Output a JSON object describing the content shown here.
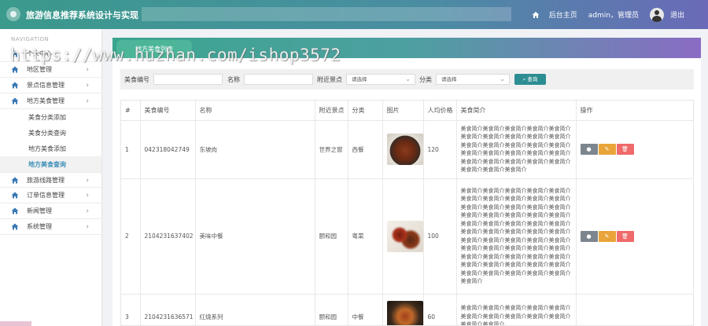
{
  "header": {
    "title": "旅游信息推荐系统设计与实现",
    "home_label": "后台主页",
    "user_label": "admin，管理员",
    "logout_label": "退出"
  },
  "sidebar": {
    "nav_head": "NAVIGATION",
    "items": [
      {
        "label": "个人中心",
        "icon": "home-icon"
      },
      {
        "label": "地区管理",
        "icon": "home-icon"
      },
      {
        "label": "景点信息管理",
        "icon": "home-icon"
      },
      {
        "label": "地方美食管理",
        "icon": "home-icon"
      }
    ],
    "sub_items": [
      {
        "label": "美食分类添加"
      },
      {
        "label": "美食分类查询"
      },
      {
        "label": "地方美食添加"
      },
      {
        "label": "地方美食查询"
      }
    ],
    "items_after": [
      {
        "label": "旅游线路管理",
        "icon": "home-icon"
      },
      {
        "label": "订单信息管理",
        "icon": "home-icon"
      },
      {
        "label": "新闻管理",
        "icon": "home-icon"
      },
      {
        "label": "系统管理",
        "icon": "home-icon"
      }
    ]
  },
  "page_tab": "地方美食列表",
  "search": {
    "code_label": "美食编号",
    "name_label": "名称",
    "spot_label": "附近景点",
    "spot_placeholder": "请选择",
    "category_label": "分类",
    "category_placeholder": "请选择",
    "button_label": "查询"
  },
  "table": {
    "columns": [
      "#",
      "美食编号",
      "名称",
      "附近景点",
      "分类",
      "图片",
      "人均价格",
      "美食简介",
      "操作"
    ],
    "rows": [
      {
        "index": "1",
        "code": "042318042749",
        "name": "东坡肉",
        "spot": "世界之窗",
        "category": "西餐",
        "image": "dongpo-pork-photo",
        "price": "120",
        "intro": "美食简介美食简介美食简介美食简介美食简介美食简介美食简介美食简介美食简介美食简介美食简介美食简介美食简介美食简介美食简介美食简介美食简介美食简介美食简介美食简介美食简介美食简介美食简介美食简介美食简介美食简介美食简介美食简介"
      },
      {
        "index": "2",
        "code": "2104231637402",
        "name": "美味中餐",
        "spot": "颐和园",
        "category": "粤菜",
        "image": "chinese-dish-photo",
        "price": "100",
        "intro": "美食简介美食简介美食简介美食简介美食简介美食简介美食简介美食简介美食简介美食简介美食简介美食简介美食简介美食简介美食简介美食简介美食简介美食简介美食简介美食简介美食简介美食简介美食简介美食简介美食简介美食简介美食简介美食简介美食简介美食简介美食简介美食简介美食简介美食简介美食简介美食简介美食简介美食简介美食简介美食简介美食简介美食简介美食简介美食简介美食简介美食简介美食简介美食简介美食简介美食简介美食简介美食简介美食简介美食简介美食简介美食简介"
      },
      {
        "index": "3",
        "code": "2104231636571",
        "name": "红烧系列",
        "spot": "颐和园",
        "category": "中餐",
        "image": "braised-dish-photo",
        "price": "60",
        "intro": "美食简介美食简介美食简介美食简介美食简介美食简介美食简介美食简介美食简介美食简介美食简介美食简介"
      }
    ],
    "ops": {
      "view": "●",
      "edit": "✎",
      "delete": "🗑"
    }
  },
  "watermark": "https://www.huzhan.com/ishop3572"
}
